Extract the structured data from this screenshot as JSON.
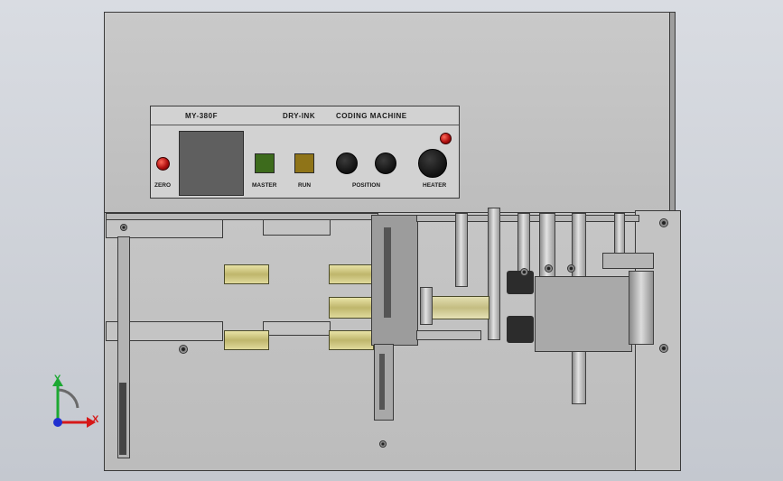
{
  "panel": {
    "model": "MY-380F",
    "type": "DRY-INK",
    "machine": "CODING MACHINE",
    "labels": {
      "zero": "ZERO",
      "master": "MASTER",
      "run": "RUN",
      "position": "POSITION",
      "heater": "HEATER"
    }
  },
  "axes": {
    "y": "Y",
    "x": "X"
  },
  "colors": {
    "master_button": "#3d6b1c",
    "run_button": "#8f7418",
    "lamp": "#c01414",
    "axis_y": "#1ca832",
    "axis_x": "#d61818",
    "axis_z": "#2030d0"
  }
}
